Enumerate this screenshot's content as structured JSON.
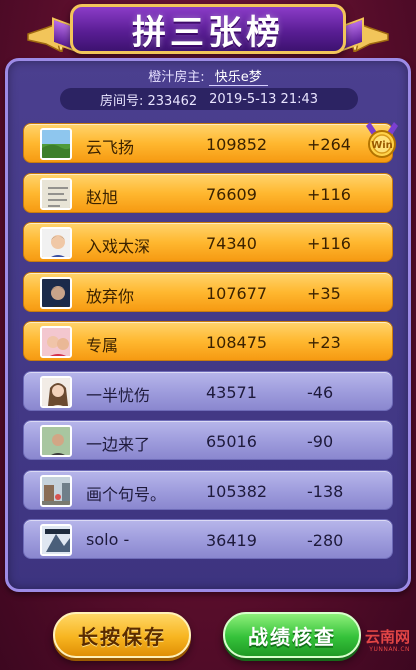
{
  "title": "拼三张榜",
  "room": {
    "owner_label": "橙汁房主:",
    "owner_name": "快乐e梦",
    "room_no_label": "房间号:",
    "room_no": "233462",
    "datetime": "2019-5-13 21:43"
  },
  "rankings": [
    {
      "name": "云飞扬",
      "score": "109852",
      "delta": "+264",
      "result": "win",
      "avatar": "landscape"
    },
    {
      "name": "赵旭",
      "score": "76609",
      "delta": "+116",
      "result": "win",
      "avatar": "paper"
    },
    {
      "name": "入戏太深",
      "score": "74340",
      "delta": "+116",
      "result": "win",
      "avatar": "person"
    },
    {
      "name": "放弃你",
      "score": "107677",
      "delta": "+35",
      "result": "win",
      "avatar": "dark-person"
    },
    {
      "name": "专属",
      "score": "108475",
      "delta": "+23",
      "result": "win",
      "avatar": "couple"
    },
    {
      "name": "一半忧伤",
      "score": "43571",
      "delta": "-46",
      "result": "lose",
      "avatar": "girl"
    },
    {
      "name": "一边来了",
      "score": "65016",
      "delta": "-90",
      "result": "lose",
      "avatar": "man"
    },
    {
      "name": "画个句号。",
      "score": "105382",
      "delta": "-138",
      "result": "lose",
      "avatar": "street"
    },
    {
      "name": "solo  -",
      "score": "36419",
      "delta": "-280",
      "result": "lose",
      "avatar": "poster"
    }
  ],
  "winner_badge": "winner-medal-icon",
  "buttons": {
    "save_label": "长按保存",
    "record_label": "战绩核查"
  },
  "watermark": {
    "text": "云南网",
    "sub": "YUNNAN.CN"
  },
  "colors": {
    "background": "#5b0e2c",
    "panel": "#4b3f8f",
    "win_row": "#ffb830",
    "lose_row": "#9d9bdc",
    "save_button": "#f7b520",
    "record_button": "#35c23a"
  }
}
